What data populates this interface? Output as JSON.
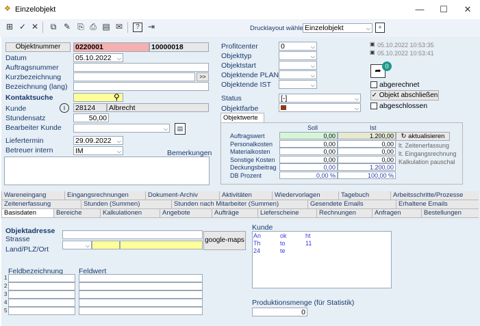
{
  "window": {
    "title": "Einzelobjekt",
    "icon": "diamond-app-icon",
    "minimize": "—",
    "maximize": "☐",
    "close": "✕"
  },
  "toolbar": {
    "print_layout_label": "Drucklayout wählen:",
    "print_layout_value": "Einzelobjekt"
  },
  "left": {
    "objektnummer_btn": "Objektnummer",
    "objektnummer": "0220001",
    "objektnummer2": "10000018",
    "datum_label": "Datum",
    "datum": "05.10.2022",
    "auftragsnummer_label": "Auftragsnummer",
    "kurzbezeichnung_label": "Kurzbezeichnung",
    "kurz_btn": ">>",
    "bezeichnung_label": "Bezeichnung (lang)",
    "kontaktsuche_label": "Kontaktsuche",
    "kunde_label": "Kunde",
    "kunde_nr": "28124",
    "kunde_name": "Albrecht",
    "stundensatz_label": "Stundensatz",
    "stundensatz": "50,00",
    "bearbeiter_label": "Bearbeiter Kunde",
    "liefertermin_label": "Liefertermin",
    "liefertermin": "29.09.2022",
    "betreuer_label": "Betreuer intern",
    "betreuer": "IM",
    "bemerkungen_label": "Bemerkungen"
  },
  "right": {
    "profitcenter_label": "Profitcenter",
    "profitcenter": "0",
    "objekttyp_label": "Objekttyp",
    "objektstart_label": "Objektstart",
    "objektende_plan_label": "Objektende PLAN",
    "objektende_ist_label": "Objektende IST",
    "status_label": "Status",
    "status": "[-]",
    "objektfarbe_label": "Objektfarbe",
    "ts1": "05.10.2022 10:53:35",
    "ts2": "05.10.2022 10:53:41",
    "badge": "0",
    "abgerechnet": "abgerechnet",
    "abschliessen_btn": "✓ Objekt abschließen",
    "abgeschlossen": "abgeschlossen"
  },
  "objektwerte": {
    "tab": "Objektwerte",
    "col_soll": "Soll",
    "col_ist": "Ist",
    "rows": [
      {
        "label": "Auftragswert",
        "soll": "0,00",
        "ist": "1.200,00"
      },
      {
        "label": "Personalkosten",
        "soll": "0,00",
        "ist": "0,00"
      },
      {
        "label": "Materialkosten",
        "soll": "0,00",
        "ist": "0,00"
      },
      {
        "label": "Sonstige Kosten",
        "soll": "0,00",
        "ist": "0,00"
      },
      {
        "label": "Deckungsbeitrag",
        "soll": "0,00",
        "ist": "1.200,00"
      },
      {
        "label": "DB Prozent",
        "soll": "0,00 %",
        "ist": "100,00 %"
      }
    ],
    "aktualisieren_btn": "aktualisieren",
    "notes": [
      "lt. Zeitenerfassung",
      "lt. Eingangsrechnung",
      "Kalkulation pauschal"
    ]
  },
  "tabs_row1": [
    "Wareneingang",
    "Eingangsrechnungen",
    "Dokument-Archiv",
    "Aktivitäten",
    "Wiedervorlagen",
    "Tagebuch",
    "Arbeitsschritte/Prozesse"
  ],
  "tabs_row2": [
    "Zeitenerfassung",
    "Stunden (Summen)",
    "Stunden nach Mitarbeiter (Summen)",
    "Gesendete Emails",
    "Erhaltene Emails"
  ],
  "tabs_row3": [
    "Basisdaten",
    "Bereiche",
    "Kalkulationen",
    "Angebote",
    "Aufträge",
    "Lieferscheine",
    "Rechnungen",
    "Anfragen",
    "Bestellungen"
  ],
  "basis": {
    "objektadresse": "Objektadresse",
    "strasse": "Strasse",
    "plz": "Land/PLZ/Ort",
    "google_btn": "google-maps",
    "kunde_label": "Kunde",
    "kunde_lines": [
      [
        "An",
        "ok",
        "ht"
      ],
      [
        "Th",
        "to",
        "11"
      ],
      [
        "24",
        "te",
        ""
      ]
    ],
    "feldbez": "Feldbezeichnung",
    "feldwert": "Feldwert",
    "row_nums": [
      "1",
      "2",
      "3",
      "4",
      "5"
    ],
    "produktion_label": "Produktionsmenge (für Statistik)",
    "produktion": "0"
  }
}
